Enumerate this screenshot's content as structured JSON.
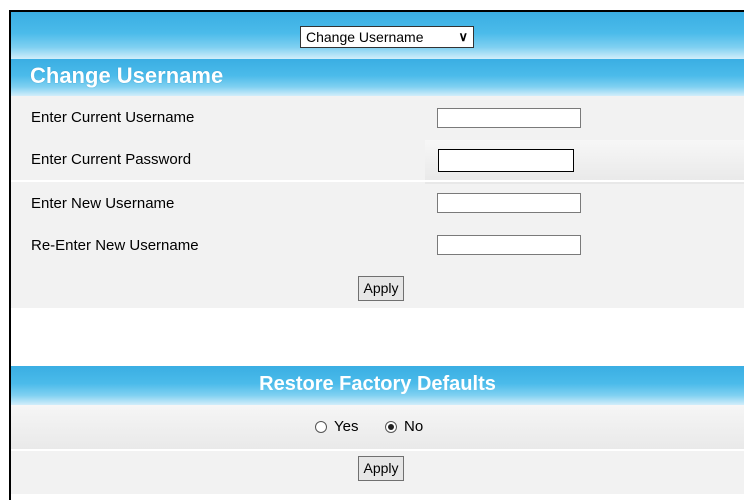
{
  "selector": {
    "selected": "Change Username"
  },
  "change_username": {
    "title": "Change Username",
    "fields": [
      {
        "label": "Enter Current Username",
        "value": ""
      },
      {
        "label": "Enter Current Password",
        "value": ""
      },
      {
        "label": "Enter New Username",
        "value": ""
      },
      {
        "label": "Re-Enter New Username",
        "value": ""
      }
    ],
    "apply_label": "Apply"
  },
  "restore_defaults": {
    "title": "Restore Factory Defaults",
    "options": [
      {
        "label": "Yes",
        "checked": false
      },
      {
        "label": "No",
        "checked": true
      }
    ],
    "apply_label": "Apply"
  },
  "icons": {
    "dropdown": "chevron-down-icon"
  },
  "colors": {
    "band": "#4bbbea",
    "panel": "#f2f2f2"
  }
}
